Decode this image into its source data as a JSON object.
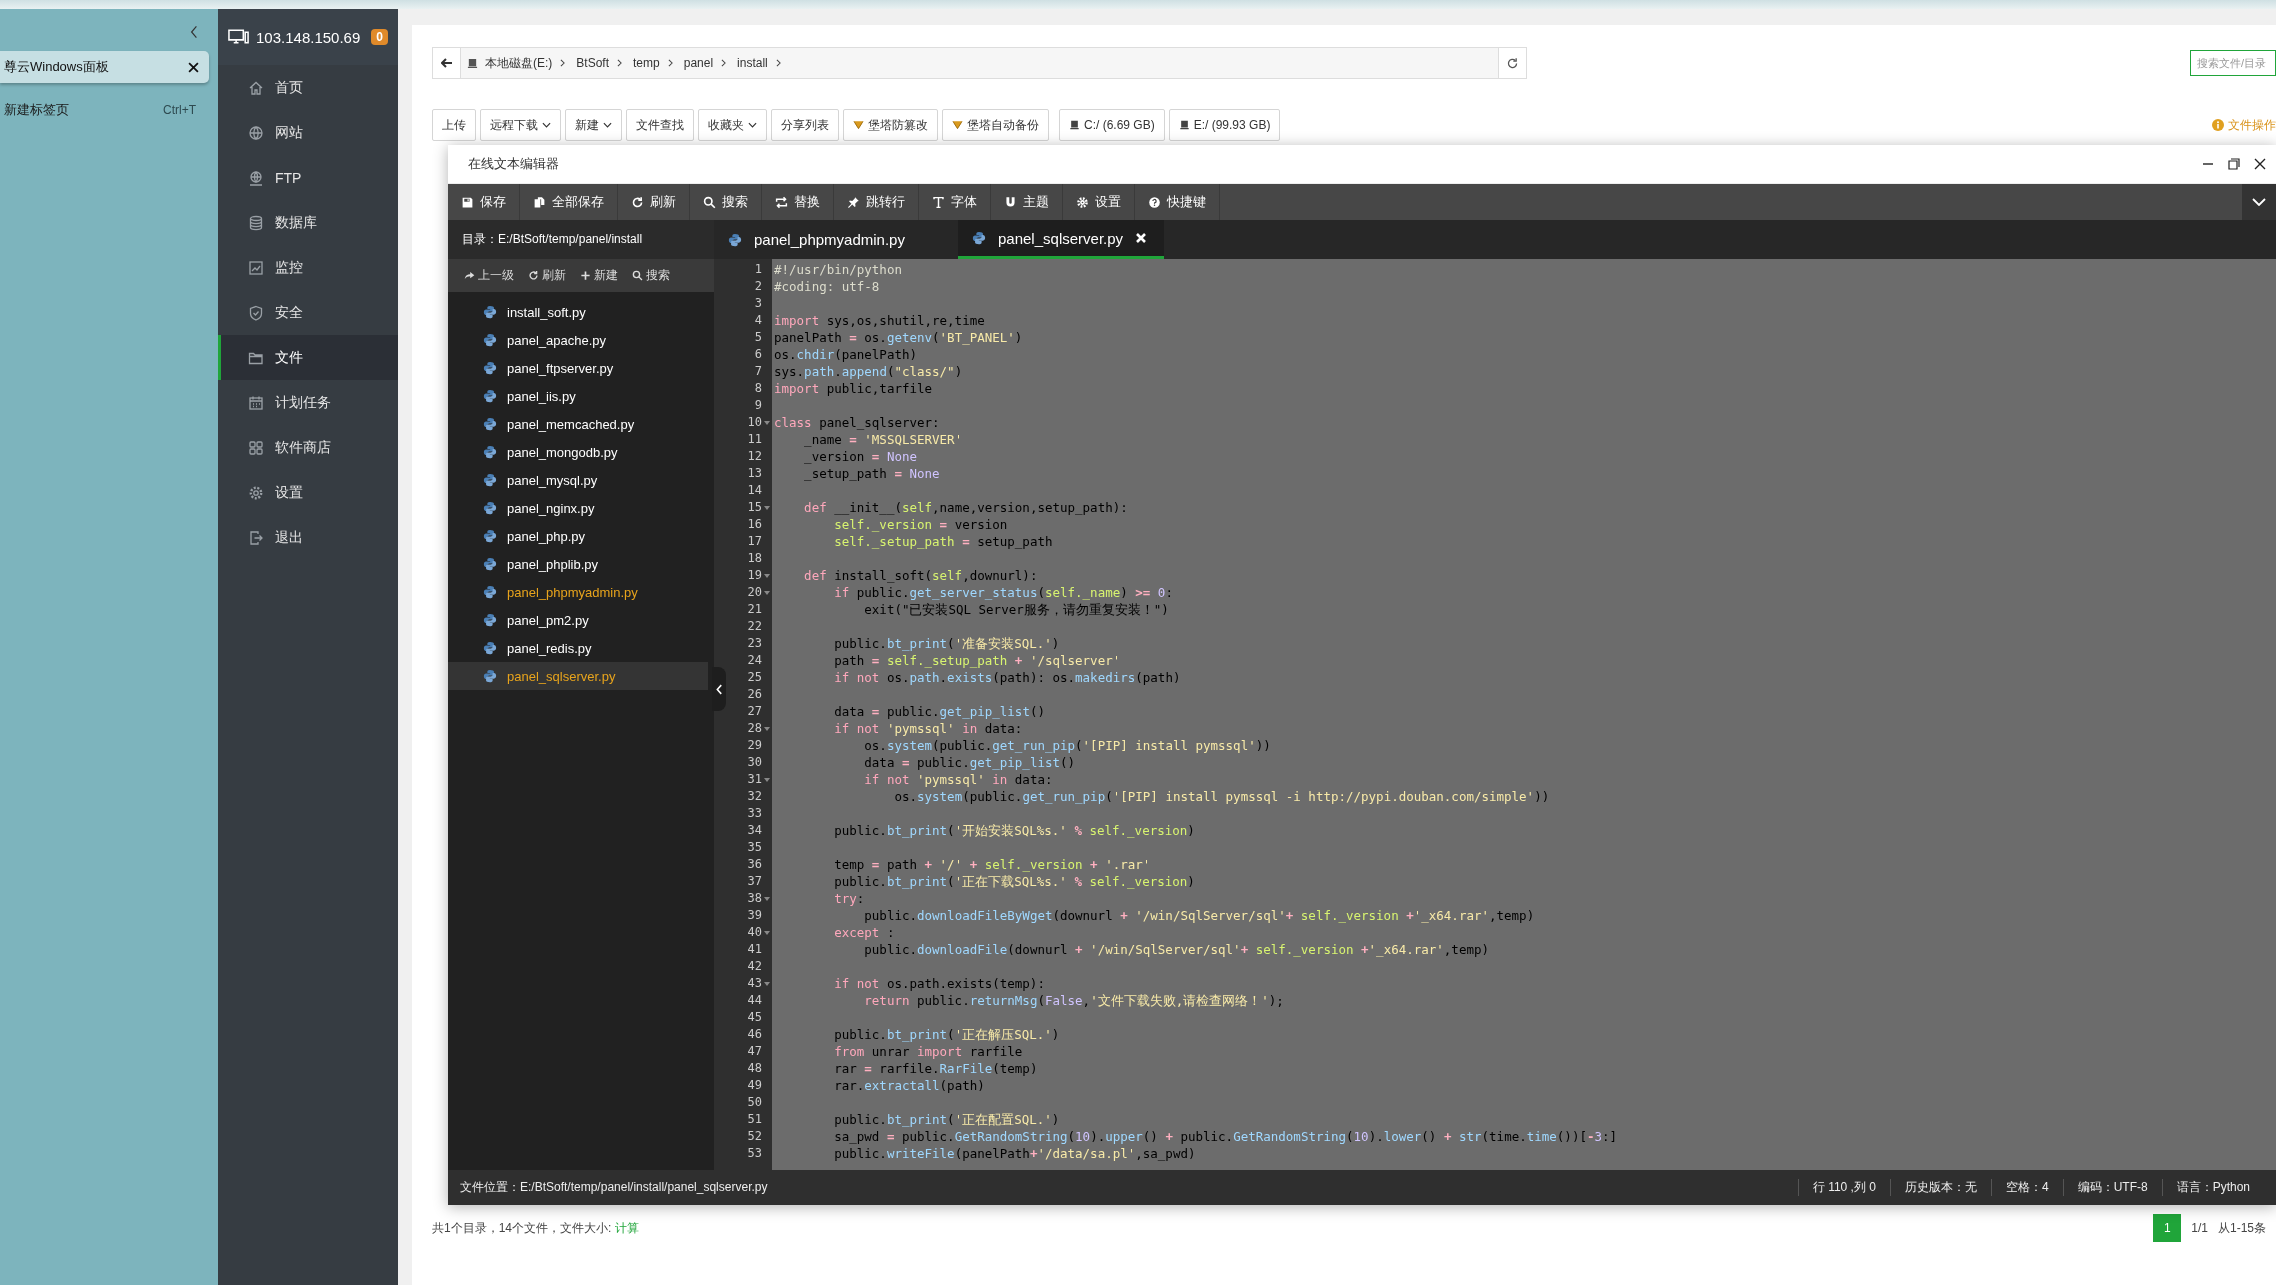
{
  "browser_panel": {
    "tabs": [
      {
        "title": "尊云Windows面板",
        "selected": true
      }
    ],
    "new_tab": {
      "label": "新建标签页",
      "shortcut": "Ctrl+T"
    }
  },
  "sidebar": {
    "server": "103.148.150.69",
    "badge": "0",
    "items": [
      {
        "label": "首页",
        "selected": false
      },
      {
        "label": "网站",
        "selected": false
      },
      {
        "label": "FTP",
        "selected": false
      },
      {
        "label": "数据库",
        "selected": false
      },
      {
        "label": "监控",
        "selected": false
      },
      {
        "label": "安全",
        "selected": false
      },
      {
        "label": "文件",
        "selected": true
      },
      {
        "label": "计划任务",
        "selected": false
      },
      {
        "label": "软件商店",
        "selected": false
      },
      {
        "label": "设置",
        "selected": false
      },
      {
        "label": "退出",
        "selected": false
      }
    ]
  },
  "breadcrumb": {
    "items": [
      "本地磁盘(E:)",
      "BtSoft",
      "temp",
      "panel",
      "install"
    ]
  },
  "search": {
    "placeholder": "搜索文件/目录"
  },
  "toolbar": {
    "buttons": [
      {
        "label": "上传",
        "kind": "plain"
      },
      {
        "label": "远程下载",
        "kind": "dropdown"
      },
      {
        "label": "新建",
        "kind": "dropdown"
      },
      {
        "label": "文件查找",
        "kind": "plain"
      },
      {
        "label": "收藏夹",
        "kind": "dropdown"
      },
      {
        "label": "分享列表",
        "kind": "plain"
      },
      {
        "label": "堡塔防篡改",
        "kind": "tool"
      },
      {
        "label": "堡塔自动备份",
        "kind": "tool"
      },
      {
        "label": "C:/ (6.69 GB)",
        "kind": "disk"
      },
      {
        "label": "E:/ (99.93 GB)",
        "kind": "disk"
      }
    ],
    "notice": "文件操作"
  },
  "editor": {
    "title": "在线文本编辑器",
    "toolbar": [
      "保存",
      "全部保存",
      "刷新",
      "搜索",
      "替换",
      "跳转行",
      "字体",
      "主题",
      "设置",
      "快捷键"
    ],
    "directory": "目录：E:/BtSoft/temp/panel/install",
    "tree_actions": [
      "上一级",
      "刷新",
      "新建",
      "搜索"
    ],
    "files": [
      {
        "name": "install_soft.py",
        "open": false,
        "selected": false
      },
      {
        "name": "panel_apache.py",
        "open": false,
        "selected": false
      },
      {
        "name": "panel_ftpserver.py",
        "open": false,
        "selected": false
      },
      {
        "name": "panel_iis.py",
        "open": false,
        "selected": false
      },
      {
        "name": "panel_memcached.py",
        "open": false,
        "selected": false
      },
      {
        "name": "panel_mongodb.py",
        "open": false,
        "selected": false
      },
      {
        "name": "panel_mysql.py",
        "open": false,
        "selected": false
      },
      {
        "name": "panel_nginx.py",
        "open": false,
        "selected": false
      },
      {
        "name": "panel_php.py",
        "open": false,
        "selected": false
      },
      {
        "name": "panel_phplib.py",
        "open": false,
        "selected": false
      },
      {
        "name": "panel_phpmyadmin.py",
        "open": true,
        "selected": false
      },
      {
        "name": "panel_pm2.py",
        "open": false,
        "selected": false
      },
      {
        "name": "panel_redis.py",
        "open": false,
        "selected": false
      },
      {
        "name": "panel_sqlserver.py",
        "open": true,
        "selected": true
      }
    ],
    "tabs": [
      {
        "name": "panel_phpmyadmin.py",
        "selected": false
      },
      {
        "name": "panel_sqlserver.py",
        "selected": true
      }
    ],
    "lines": [
      {
        "number": "1",
        "fold": false,
        "tokens": [
          {
            "kind": "cm",
            "text": "#!/usr/bin/python"
          }
        ]
      },
      {
        "number": "2",
        "fold": false,
        "tokens": [
          {
            "kind": "cm",
            "text": "#coding: utf-8"
          }
        ]
      },
      {
        "number": "3",
        "fold": false
      },
      {
        "number": "4",
        "fold": false,
        "tokens": [
          {
            "kind": "kw",
            "text": "import"
          },
          {
            "kind": "p",
            "text": " sys,os,shutil,re,time"
          }
        ]
      },
      {
        "number": "5",
        "fold": false,
        "tokens": [
          {
            "kind": "p",
            "text": "panelPath "
          },
          {
            "kind": "op",
            "text": "="
          },
          {
            "kind": "p",
            "text": " os."
          },
          {
            "kind": "fn",
            "text": "getenv"
          },
          {
            "kind": "p",
            "text": "("
          },
          {
            "kind": "str",
            "text": "'BT_PANEL'"
          },
          {
            "kind": "p",
            "text": ")"
          }
        ]
      },
      {
        "number": "6",
        "fold": false,
        "tokens": [
          {
            "kind": "p",
            "text": "os."
          },
          {
            "kind": "fn",
            "text": "chdir"
          },
          {
            "kind": "p",
            "text": "(panelPath)"
          }
        ]
      },
      {
        "number": "7",
        "fold": false,
        "tokens": [
          {
            "kind": "p",
            "text": "sys."
          },
          {
            "kind": "fn",
            "text": "path"
          },
          {
            "kind": "p",
            "text": "."
          },
          {
            "kind": "fn",
            "text": "append"
          },
          {
            "kind": "p",
            "text": "("
          },
          {
            "kind": "str",
            "text": "\"class/\""
          },
          {
            "kind": "p",
            "text": ")"
          }
        ]
      },
      {
        "number": "8",
        "fold": false,
        "tokens": [
          {
            "kind": "kw",
            "text": "import"
          },
          {
            "kind": "p",
            "text": " public,tarfile"
          }
        ]
      },
      {
        "number": "9",
        "fold": false
      },
      {
        "number": "10",
        "fold": true,
        "tokens": [
          {
            "kind": "kw",
            "text": "class"
          },
          {
            "kind": "p",
            "text": " panel_sqlserver:"
          }
        ]
      },
      {
        "number": "11",
        "fold": false,
        "tokens": [
          {
            "kind": "p",
            "text": "    _name "
          },
          {
            "kind": "op",
            "text": "="
          },
          {
            "kind": "str",
            "text": " 'MSSQLSERVER'"
          }
        ]
      },
      {
        "number": "12",
        "fold": false,
        "tokens": [
          {
            "kind": "p",
            "text": "    _version "
          },
          {
            "kind": "op",
            "text": "="
          },
          {
            "kind": "num",
            "text": " None"
          }
        ]
      },
      {
        "number": "13",
        "fold": false,
        "tokens": [
          {
            "kind": "p",
            "text": "    _setup_path "
          },
          {
            "kind": "op",
            "text": "="
          },
          {
            "kind": "num",
            "text": " None"
          }
        ]
      },
      {
        "number": "14",
        "fold": false
      },
      {
        "number": "15",
        "fold": true,
        "tokens": [
          {
            "kind": "kw",
            "text": "    def"
          },
          {
            "kind": "p",
            "text": " __init__("
          },
          {
            "kind": "self",
            "text": "self"
          },
          {
            "kind": "p",
            "text": ",name,version,setup_path):"
          }
        ]
      },
      {
        "number": "16",
        "fold": false,
        "tokens": [
          {
            "kind": "self",
            "text": "        self._version"
          },
          {
            "kind": "op",
            "text": " ="
          },
          {
            "kind": "p",
            "text": " version"
          }
        ]
      },
      {
        "number": "17",
        "fold": false,
        "tokens": [
          {
            "kind": "self",
            "text": "        self._setup_path"
          },
          {
            "kind": "op",
            "text": " ="
          },
          {
            "kind": "p",
            "text": " setup_path"
          }
        ]
      },
      {
        "number": "18",
        "fold": false
      },
      {
        "number": "19",
        "fold": true,
        "tokens": [
          {
            "kind": "kw",
            "text": "    def"
          },
          {
            "kind": "p",
            "text": " install_soft("
          },
          {
            "kind": "self",
            "text": "self"
          },
          {
            "kind": "p",
            "text": ",downurl):"
          }
        ]
      },
      {
        "number": "20",
        "fold": true,
        "tokens": [
          {
            "kind": "kw",
            "text": "        if"
          },
          {
            "kind": "p",
            "text": " public."
          },
          {
            "kind": "fn",
            "text": "get_server_status"
          },
          {
            "kind": "p",
            "text": "("
          },
          {
            "kind": "self",
            "text": "self._name"
          },
          {
            "kind": "p",
            "text": ") "
          },
          {
            "kind": "op",
            "text": ">="
          },
          {
            "kind": "num",
            "text": " 0"
          },
          {
            "kind": "p",
            "text": ":"
          }
        ]
      },
      {
        "number": "21",
        "fold": false,
        "tokens": [
          {
            "kind": "p",
            "text": "            exit(\"已安装SQL Server服务，请勿重复安装！\")"
          }
        ]
      },
      {
        "number": "22",
        "fold": false
      },
      {
        "number": "23",
        "fold": false,
        "tokens": [
          {
            "kind": "p",
            "text": "        public."
          },
          {
            "kind": "fn",
            "text": "bt_print"
          },
          {
            "kind": "p",
            "text": "("
          },
          {
            "kind": "str",
            "text": "'准备安装SQL.'"
          },
          {
            "kind": "p",
            "text": ")"
          }
        ]
      },
      {
        "number": "24",
        "fold": false,
        "tokens": [
          {
            "kind": "p",
            "text": "        path "
          },
          {
            "kind": "op",
            "text": "="
          },
          {
            "kind": "self",
            "text": " self._setup_path"
          },
          {
            "kind": "op",
            "text": " +"
          },
          {
            "kind": "str",
            "text": " '/sqlserver'"
          }
        ]
      },
      {
        "number": "25",
        "fold": false,
        "tokens": [
          {
            "kind": "kw",
            "text": "        if not"
          },
          {
            "kind": "p",
            "text": " os."
          },
          {
            "kind": "fn",
            "text": "path"
          },
          {
            "kind": "p",
            "text": "."
          },
          {
            "kind": "fn",
            "text": "exists"
          },
          {
            "kind": "p",
            "text": "(path): os."
          },
          {
            "kind": "fn",
            "text": "makedirs"
          },
          {
            "kind": "p",
            "text": "(path)"
          }
        ]
      },
      {
        "number": "26",
        "fold": false
      },
      {
        "number": "27",
        "fold": false,
        "tokens": [
          {
            "kind": "p",
            "text": "        data "
          },
          {
            "kind": "op",
            "text": "="
          },
          {
            "kind": "p",
            "text": " public."
          },
          {
            "kind": "fn",
            "text": "get_pip_list"
          },
          {
            "kind": "p",
            "text": "()"
          }
        ]
      },
      {
        "number": "28",
        "fold": true,
        "tokens": [
          {
            "kind": "kw",
            "text": "        if not"
          },
          {
            "kind": "str",
            "text": " 'pymssql'"
          },
          {
            "kind": "kw",
            "text": " in"
          },
          {
            "kind": "p",
            "text": " data:"
          }
        ]
      },
      {
        "number": "29",
        "fold": false,
        "tokens": [
          {
            "kind": "p",
            "text": "            os."
          },
          {
            "kind": "fn",
            "text": "system"
          },
          {
            "kind": "p",
            "text": "(public."
          },
          {
            "kind": "fn",
            "text": "get_run_pip"
          },
          {
            "kind": "p",
            "text": "("
          },
          {
            "kind": "str",
            "text": "'[PIP] install pymssql'"
          },
          {
            "kind": "p",
            "text": "))"
          }
        ]
      },
      {
        "number": "30",
        "fold": false,
        "tokens": [
          {
            "kind": "p",
            "text": "            data "
          },
          {
            "kind": "op",
            "text": "="
          },
          {
            "kind": "p",
            "text": " public."
          },
          {
            "kind": "fn",
            "text": "get_pip_list"
          },
          {
            "kind": "p",
            "text": "()"
          }
        ]
      },
      {
        "number": "31",
        "fold": true,
        "tokens": [
          {
            "kind": "kw",
            "text": "            if not"
          },
          {
            "kind": "str",
            "text": " 'pymssql'"
          },
          {
            "kind": "kw",
            "text": " in"
          },
          {
            "kind": "p",
            "text": " data:"
          }
        ]
      },
      {
        "number": "32",
        "fold": false,
        "tokens": [
          {
            "kind": "p",
            "text": "                os."
          },
          {
            "kind": "fn",
            "text": "system"
          },
          {
            "kind": "p",
            "text": "(public."
          },
          {
            "kind": "fn",
            "text": "get_run_pip"
          },
          {
            "kind": "p",
            "text": "("
          },
          {
            "kind": "str",
            "text": "'[PIP] install pymssql -i http://pypi.douban.com/simple'"
          },
          {
            "kind": "p",
            "text": "))"
          }
        ]
      },
      {
        "number": "33",
        "fold": false
      },
      {
        "number": "34",
        "fold": false,
        "tokens": [
          {
            "kind": "p",
            "text": "        public."
          },
          {
            "kind": "fn",
            "text": "bt_print"
          },
          {
            "kind": "p",
            "text": "("
          },
          {
            "kind": "str",
            "text": "'开始安装SQL%s.'"
          },
          {
            "kind": "op",
            "text": " %"
          },
          {
            "kind": "self",
            "text": " self._version"
          },
          {
            "kind": "p",
            "text": ")"
          }
        ]
      },
      {
        "number": "35",
        "fold": false
      },
      {
        "number": "36",
        "fold": false,
        "tokens": [
          {
            "kind": "p",
            "text": "        temp "
          },
          {
            "kind": "op",
            "text": "="
          },
          {
            "kind": "p",
            "text": " path "
          },
          {
            "kind": "op",
            "text": "+"
          },
          {
            "kind": "str",
            "text": " '/'"
          },
          {
            "kind": "op",
            "text": " +"
          },
          {
            "kind": "self",
            "text": " self._version"
          },
          {
            "kind": "op",
            "text": " +"
          },
          {
            "kind": "str",
            "text": " '.rar'"
          }
        ]
      },
      {
        "number": "37",
        "fold": false,
        "tokens": [
          {
            "kind": "p",
            "text": "        public."
          },
          {
            "kind": "fn",
            "text": "bt_print"
          },
          {
            "kind": "p",
            "text": "("
          },
          {
            "kind": "str",
            "text": "'正在下载SQL%s.'"
          },
          {
            "kind": "op",
            "text": " %"
          },
          {
            "kind": "self",
            "text": " self._version"
          },
          {
            "kind": "p",
            "text": ")"
          }
        ]
      },
      {
        "number": "38",
        "fold": true,
        "tokens": [
          {
            "kind": "kw",
            "text": "        try"
          },
          {
            "kind": "p",
            "text": ":"
          }
        ]
      },
      {
        "number": "39",
        "fold": false,
        "tokens": [
          {
            "kind": "p",
            "text": "            public."
          },
          {
            "kind": "fn",
            "text": "downloadFileByWget"
          },
          {
            "kind": "p",
            "text": "(downurl "
          },
          {
            "kind": "op",
            "text": "+"
          },
          {
            "kind": "str",
            "text": " '/win/SqlServer/sql'"
          },
          {
            "kind": "op",
            "text": "+"
          },
          {
            "kind": "self",
            "text": " self._version"
          },
          {
            "kind": "op",
            "text": " +"
          },
          {
            "kind": "str",
            "text": "'_x64.rar'"
          },
          {
            "kind": "p",
            "text": ",temp)"
          }
        ]
      },
      {
        "number": "40",
        "fold": true,
        "tokens": [
          {
            "kind": "kw",
            "text": "        except"
          },
          {
            "kind": "p",
            "text": " :"
          }
        ]
      },
      {
        "number": "41",
        "fold": false,
        "tokens": [
          {
            "kind": "p",
            "text": "            public."
          },
          {
            "kind": "fn",
            "text": "downloadFile"
          },
          {
            "kind": "p",
            "text": "(downurl "
          },
          {
            "kind": "op",
            "text": "+"
          },
          {
            "kind": "str",
            "text": " '/win/SqlServer/sql'"
          },
          {
            "kind": "op",
            "text": "+"
          },
          {
            "kind": "self",
            "text": " self._version"
          },
          {
            "kind": "op",
            "text": " +"
          },
          {
            "kind": "str",
            "text": "'_x64.rar'"
          },
          {
            "kind": "p",
            "text": ",temp)"
          }
        ]
      },
      {
        "number": "42",
        "fold": false
      },
      {
        "number": "43",
        "fold": true,
        "tokens": [
          {
            "kind": "kw",
            "text": "        if not"
          },
          {
            "kind": "p",
            "text": " os.path.exists(temp):"
          }
        ]
      },
      {
        "number": "44",
        "fold": false,
        "tokens": [
          {
            "kind": "kw",
            "text": "            return"
          },
          {
            "kind": "p",
            "text": " public."
          },
          {
            "kind": "fn",
            "text": "returnMsg"
          },
          {
            "kind": "p",
            "text": "("
          },
          {
            "kind": "num",
            "text": "False"
          },
          {
            "kind": "p",
            "text": ","
          },
          {
            "kind": "str",
            "text": "'文件下载失败,请检查网络！'"
          },
          {
            "kind": "p",
            "text": ");"
          }
        ]
      },
      {
        "number": "45",
        "fold": false
      },
      {
        "number": "46",
        "fold": false,
        "tokens": [
          {
            "kind": "p",
            "text": "        public."
          },
          {
            "kind": "fn",
            "text": "bt_print"
          },
          {
            "kind": "p",
            "text": "("
          },
          {
            "kind": "str",
            "text": "'正在解压SQL.'"
          },
          {
            "kind": "p",
            "text": ")"
          }
        ]
      },
      {
        "number": "47",
        "fold": false,
        "tokens": [
          {
            "kind": "kw",
            "text": "        from"
          },
          {
            "kind": "p",
            "text": " unrar "
          },
          {
            "kind": "kw",
            "text": "import"
          },
          {
            "kind": "p",
            "text": " rarfile"
          }
        ]
      },
      {
        "number": "48",
        "fold": false,
        "tokens": [
          {
            "kind": "p",
            "text": "        rar "
          },
          {
            "kind": "op",
            "text": "="
          },
          {
            "kind": "p",
            "text": " rarfile."
          },
          {
            "kind": "fn",
            "text": "RarFile"
          },
          {
            "kind": "p",
            "text": "(temp)"
          }
        ]
      },
      {
        "number": "49",
        "fold": false,
        "tokens": [
          {
            "kind": "p",
            "text": "        rar."
          },
          {
            "kind": "fn",
            "text": "extractall"
          },
          {
            "kind": "p",
            "text": "(path)"
          }
        ]
      },
      {
        "number": "50",
        "fold": false
      },
      {
        "number": "51",
        "fold": false,
        "tokens": [
          {
            "kind": "p",
            "text": "        public."
          },
          {
            "kind": "fn",
            "text": "bt_print"
          },
          {
            "kind": "p",
            "text": "("
          },
          {
            "kind": "str",
            "text": "'正在配置SQL.'"
          },
          {
            "kind": "p",
            "text": ")"
          }
        ]
      },
      {
        "number": "52",
        "fold": false,
        "tokens": [
          {
            "kind": "p",
            "text": "        sa_pwd "
          },
          {
            "kind": "op",
            "text": "="
          },
          {
            "kind": "p",
            "text": " public."
          },
          {
            "kind": "fn",
            "text": "GetRandomString"
          },
          {
            "kind": "p",
            "text": "("
          },
          {
            "kind": "num",
            "text": "10"
          },
          {
            "kind": "p",
            "text": ")."
          },
          {
            "kind": "fn",
            "text": "upper"
          },
          {
            "kind": "p",
            "text": "() "
          },
          {
            "kind": "op",
            "text": "+"
          },
          {
            "kind": "p",
            "text": " public."
          },
          {
            "kind": "fn",
            "text": "GetRandomString"
          },
          {
            "kind": "p",
            "text": "("
          },
          {
            "kind": "num",
            "text": "10"
          },
          {
            "kind": "p",
            "text": ")."
          },
          {
            "kind": "fn",
            "text": "lower"
          },
          {
            "kind": "p",
            "text": "() "
          },
          {
            "kind": "op",
            "text": "+"
          },
          {
            "kind": "fn",
            "text": " str"
          },
          {
            "kind": "p",
            "text": "(time."
          },
          {
            "kind": "fn",
            "text": "time"
          },
          {
            "kind": "p",
            "text": "())["
          },
          {
            "kind": "op",
            "text": "-"
          },
          {
            "kind": "num",
            "text": "3"
          },
          {
            "kind": "p",
            "text": ":]"
          }
        ]
      },
      {
        "number": "53",
        "fold": false,
        "tokens": [
          {
            "kind": "p",
            "text": "        public."
          },
          {
            "kind": "fn",
            "text": "writeFile"
          },
          {
            "kind": "p",
            "text": "(panelPath"
          },
          {
            "kind": "op",
            "text": "+"
          },
          {
            "kind": "str",
            "text": "'/data/sa.pl'"
          },
          {
            "kind": "p",
            "text": ",sa_pwd)"
          }
        ]
      }
    ],
    "status": {
      "path": "文件位置：E:/BtSoft/temp/panel/install/panel_sqlserver.py",
      "items": [
        "行 110 ,列 0",
        "历史版本：无",
        "空格：4",
        "编码：UTF-8",
        "语言：Python"
      ]
    }
  },
  "footer": {
    "summary": "共1个目录，14个文件，文件大小: ",
    "link": "计算"
  },
  "pagination": {
    "pages": [
      {
        "label": "1",
        "selected": true
      }
    ],
    "info": "1/1",
    "range": "从1-15条"
  }
}
